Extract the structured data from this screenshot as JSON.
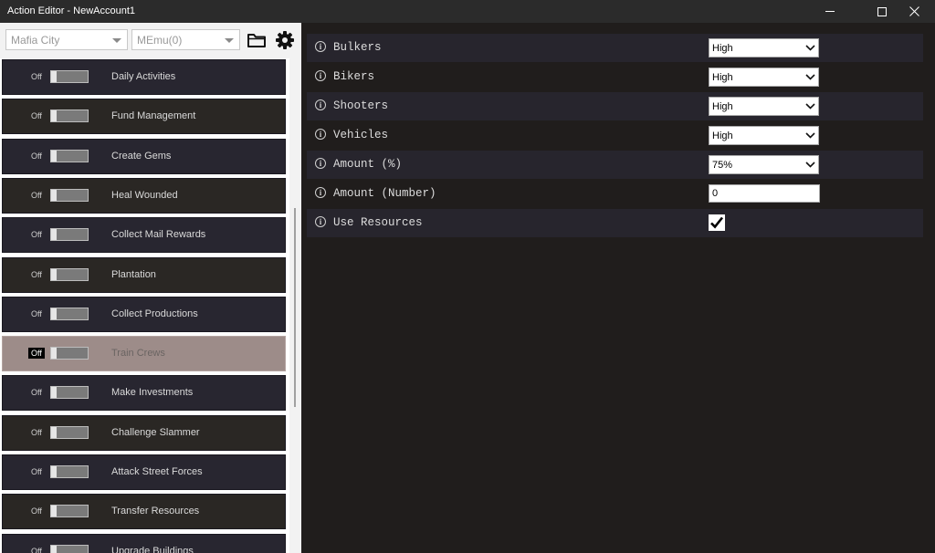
{
  "window": {
    "title": "Action Editor - NewAccount1"
  },
  "toolbar": {
    "game_select": "Mafia City",
    "emulator_select": "MEmu(0)",
    "folder_icon": "folder-icon",
    "gear_icon": "gear-icon"
  },
  "actions": [
    {
      "state": "Off",
      "label": "Daily Activities"
    },
    {
      "state": "Off",
      "label": "Fund Management"
    },
    {
      "state": "Off",
      "label": "Create Gems"
    },
    {
      "state": "Off",
      "label": "Heal Wounded"
    },
    {
      "state": "Off",
      "label": "Collect Mail Rewards"
    },
    {
      "state": "Off",
      "label": "Plantation"
    },
    {
      "state": "Off",
      "label": "Collect Productions"
    },
    {
      "state": "Off",
      "label": "Train Crews"
    },
    {
      "state": "Off",
      "label": "Make Investments"
    },
    {
      "state": "Off",
      "label": "Challenge Slammer"
    },
    {
      "state": "Off",
      "label": "Attack Street Forces"
    },
    {
      "state": "Off",
      "label": "Transfer Resources"
    },
    {
      "state": "Off",
      "label": "Upgrade Buildings"
    }
  ],
  "selected_action": "Train Crews",
  "settings": [
    {
      "label": "Bulkers",
      "type": "select",
      "value": "High"
    },
    {
      "label": "Bikers",
      "type": "select",
      "value": "High"
    },
    {
      "label": "Shooters",
      "type": "select",
      "value": "High"
    },
    {
      "label": "Vehicles",
      "type": "select",
      "value": "High"
    },
    {
      "label": "Amount (%)",
      "type": "select",
      "value": "75%"
    },
    {
      "label": "Amount (Number)",
      "type": "text",
      "value": "0"
    },
    {
      "label": "Use Resources",
      "type": "checkbox",
      "value": "checked"
    }
  ]
}
